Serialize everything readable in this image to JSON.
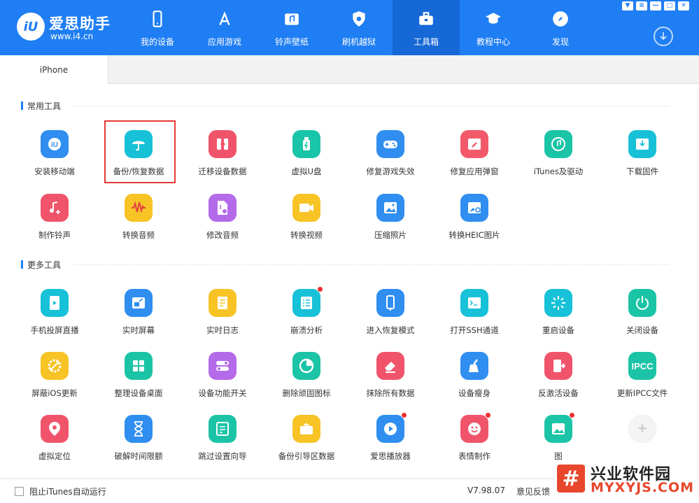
{
  "app": {
    "logo_mark": "iU",
    "logo_name": "爱思助手",
    "logo_url": "www.i4.cn"
  },
  "nav": [
    {
      "label": "我的设备",
      "icon": "phone-icon"
    },
    {
      "label": "应用游戏",
      "icon": "app-store-icon"
    },
    {
      "label": "铃声壁纸",
      "icon": "music-icon"
    },
    {
      "label": "刷机越狱",
      "icon": "shield-icon"
    },
    {
      "label": "工具箱",
      "icon": "toolbox-icon",
      "active": true
    },
    {
      "label": "教程中心",
      "icon": "graduation-cap-icon"
    },
    {
      "label": "发现",
      "icon": "compass-icon"
    }
  ],
  "window_controls": {
    "skin": "▼",
    "menu": "≡",
    "minimize": "—",
    "maximize": "□",
    "close": "✕"
  },
  "device_tab": "iPhone",
  "sections": {
    "common": "常用工具",
    "more": "更多工具"
  },
  "common_tools": [
    {
      "label": "安装移动端",
      "icon": "i4-logo-icon",
      "color": "#2f8ef0"
    },
    {
      "label": "备份/恢复数据",
      "icon": "umbrella-icon",
      "color": "#17c1d8"
    },
    {
      "label": "迁移设备数据",
      "icon": "transfer-icon",
      "color": "#f0546b"
    },
    {
      "label": "虚拟U盘",
      "icon": "usb-drive-icon",
      "color": "#19c5a8"
    },
    {
      "label": "修复游戏失效",
      "icon": "gamepad-icon",
      "color": "#2f8ef0"
    },
    {
      "label": "修复应用弹窗",
      "icon": "wrench-window-icon",
      "color": "#f25a6a"
    },
    {
      "label": "iTunes及驱动",
      "icon": "itunes-icon",
      "color": "#1bc4a6"
    },
    {
      "label": "下载固件",
      "icon": "download-box-icon",
      "color": "#17c1d8"
    },
    {
      "label": "制作铃声",
      "icon": "music-note-plus-icon",
      "color": "#f0546b"
    },
    {
      "label": "转换音频",
      "icon": "waveform-icon",
      "color": "#f7c325"
    },
    {
      "label": "修改音频",
      "icon": "audio-file-gear-icon",
      "color": "#b36bea"
    },
    {
      "label": "转换视频",
      "icon": "video-camera-icon",
      "color": "#f7c325"
    },
    {
      "label": "压缩照片",
      "icon": "photo-icon",
      "color": "#2f8ef0"
    },
    {
      "label": "转换HEIC图片",
      "icon": "photo-convert-icon",
      "color": "#2f8ef0"
    }
  ],
  "more_tools": [
    {
      "label": "手机投屏直播",
      "icon": "screen-cast-icon",
      "color": "#17c1d8"
    },
    {
      "label": "实时屏幕",
      "icon": "live-screen-icon",
      "color": "#2f8ef0"
    },
    {
      "label": "实时日志",
      "icon": "log-document-icon",
      "color": "#f7c325"
    },
    {
      "label": "崩溃分析",
      "icon": "crash-report-icon",
      "color": "#17c1d8",
      "badge": true
    },
    {
      "label": "进入恢复模式",
      "icon": "recovery-phone-icon",
      "color": "#2f8ef0"
    },
    {
      "label": "打开SSH通道",
      "icon": "terminal-icon",
      "color": "#17c1d8"
    },
    {
      "label": "重启设备",
      "icon": "restart-spark-icon",
      "color": "#17c1d8"
    },
    {
      "label": "关闭设备",
      "icon": "power-icon",
      "color": "#1bc4a6"
    },
    {
      "label": "屏蔽iOS更新",
      "icon": "block-update-gear-icon",
      "color": "#f7c325"
    },
    {
      "label": "整理设备桌面",
      "icon": "grid-apps-icon",
      "color": "#1bc4a6"
    },
    {
      "label": "设备功能开关",
      "icon": "toggle-switch-icon",
      "color": "#b36bea"
    },
    {
      "label": "删除顽固图标",
      "icon": "pie-clock-icon",
      "color": "#1bc4a6"
    },
    {
      "label": "抹除所有数据",
      "icon": "eraser-icon",
      "color": "#f0546b"
    },
    {
      "label": "设备瘦身",
      "icon": "broom-icon",
      "color": "#2f8ef0"
    },
    {
      "label": "反激活设备",
      "icon": "deactivate-phone-icon",
      "color": "#f0546b"
    },
    {
      "label": "更新IPCC文件",
      "icon": "ipcc-icon",
      "color": "#1bc4a6",
      "text": "IPCC"
    },
    {
      "label": "虚拟定位",
      "icon": "location-pin-icon",
      "color": "#f0546b"
    },
    {
      "label": "破解时间限额",
      "icon": "hourglass-icon",
      "color": "#2f8ef0"
    },
    {
      "label": "跳过设置向导",
      "icon": "skip-wizard-icon",
      "color": "#1bc4a6"
    },
    {
      "label": "备份引导区数据",
      "icon": "boot-backup-icon",
      "color": "#f7c325"
    },
    {
      "label": "爱思播放器",
      "icon": "play-button-icon",
      "color": "#2f8ef0",
      "badge": true
    },
    {
      "label": "表情制作",
      "icon": "emoji-face-icon",
      "color": "#f0546b",
      "badge": true
    },
    {
      "label": "图",
      "icon": "image-frame-icon",
      "color": "#1bc4a6",
      "badge": true
    },
    {
      "label": "",
      "icon": "add-plus-icon",
      "color": "#f4f4f4",
      "text": "+"
    }
  ],
  "footer": {
    "checkbox_label": "阻止iTunes自动运行",
    "version": "V7.98.07",
    "feedback": "意见反馈"
  },
  "watermark": {
    "logo": "#",
    "name": "兴业软件园",
    "url": "MYXYJS.COM"
  }
}
